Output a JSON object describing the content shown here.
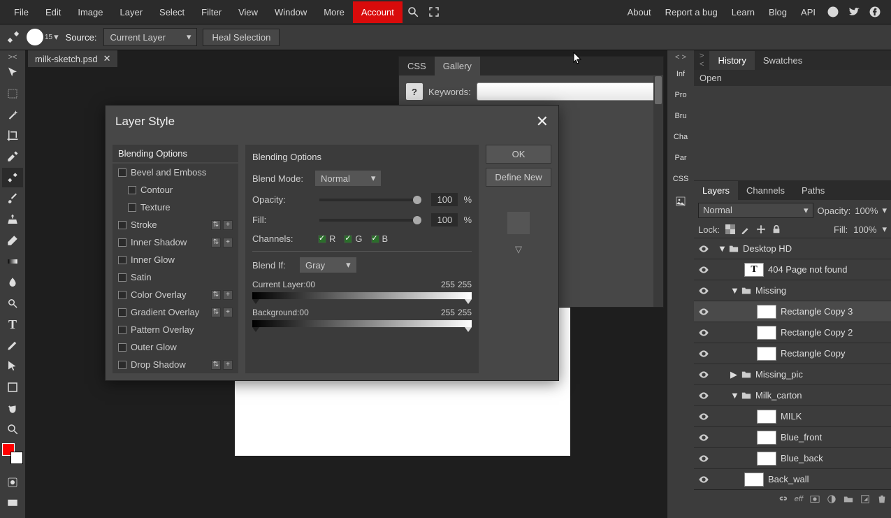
{
  "menubar": {
    "items": [
      "File",
      "Edit",
      "Image",
      "Layer",
      "Select",
      "Filter",
      "View",
      "Window",
      "More"
    ],
    "account": "Account",
    "right": [
      "About",
      "Report a bug",
      "Learn",
      "Blog",
      "API"
    ]
  },
  "optbar": {
    "brush_size": "15",
    "source_label": "Source:",
    "source_value": "Current Layer",
    "heal_btn": "Heal Selection"
  },
  "doc": {
    "tab_name": "milk-sketch.psd"
  },
  "gallery": {
    "tabs": [
      "CSS",
      "Gallery"
    ],
    "help": "?",
    "keywords_label": "Keywords:"
  },
  "sidetabs": [
    "Inf",
    "Pro",
    "Bru",
    "Cha",
    "Par",
    "CSS"
  ],
  "history_panel": {
    "tabs": [
      "History",
      "Swatches"
    ],
    "items": [
      "Open"
    ]
  },
  "layers_panel": {
    "tabs": [
      "Layers",
      "Channels",
      "Paths"
    ],
    "blend_mode": "Normal",
    "opacity_label": "Opacity:",
    "opacity_val": "100%",
    "lock_label": "Lock:",
    "fill_label": "Fill:",
    "fill_val": "100%",
    "rows": [
      {
        "name": "Desktop HD",
        "type": "folder",
        "open": true,
        "indent": 0
      },
      {
        "name": "404 Page not found",
        "type": "text",
        "indent": 1
      },
      {
        "name": "Missing",
        "type": "folder",
        "open": true,
        "indent": 1
      },
      {
        "name": "Rectangle Copy 3",
        "type": "shape",
        "indent": 2,
        "sel": true
      },
      {
        "name": "Rectangle Copy 2",
        "type": "shape",
        "indent": 2
      },
      {
        "name": "Rectangle Copy",
        "type": "shape",
        "indent": 2
      },
      {
        "name": "Missing_pic",
        "type": "folder",
        "open": false,
        "indent": 1
      },
      {
        "name": "Milk_carton",
        "type": "folder",
        "open": true,
        "indent": 1
      },
      {
        "name": "MILK",
        "type": "img",
        "indent": 2
      },
      {
        "name": "Blue_front",
        "type": "img",
        "indent": 2
      },
      {
        "name": "Blue_back",
        "type": "img",
        "indent": 2
      },
      {
        "name": "Back_wall",
        "type": "img",
        "indent": 1
      }
    ],
    "footer_eff": "eff"
  },
  "dialog": {
    "title": "Layer Style",
    "effects_header": "Blending Options",
    "effects": [
      {
        "label": "Bevel and Emboss",
        "cb": true
      },
      {
        "label": "Contour",
        "cb": true,
        "sub": true
      },
      {
        "label": "Texture",
        "cb": true,
        "sub": true
      },
      {
        "label": "Stroke",
        "cb": true,
        "acts": true
      },
      {
        "label": "Inner Shadow",
        "cb": true,
        "acts": true
      },
      {
        "label": "Inner Glow",
        "cb": true
      },
      {
        "label": "Satin",
        "cb": true
      },
      {
        "label": "Color Overlay",
        "cb": true,
        "acts": true
      },
      {
        "label": "Gradient Overlay",
        "cb": true,
        "acts": true
      },
      {
        "label": "Pattern Overlay",
        "cb": true
      },
      {
        "label": "Outer Glow",
        "cb": true
      },
      {
        "label": "Drop Shadow",
        "cb": true,
        "acts": true
      }
    ],
    "opts": {
      "header": "Blending Options",
      "blend_mode_l": "Blend Mode:",
      "blend_mode_v": "Normal",
      "opacity_l": "Opacity:",
      "opacity_v": "100",
      "pct": "%",
      "fill_l": "Fill:",
      "fill_v": "100",
      "channels_l": "Channels:",
      "ch_r": "R",
      "ch_g": "G",
      "ch_b": "B",
      "blendif_l": "Blend If:",
      "blendif_v": "Gray",
      "curlayer_l": "Current Layer:",
      "bg_l": "Background:",
      "v0a": "0",
      "v0b": "0",
      "v255a": "255",
      "v255b": "255"
    },
    "ok": "OK",
    "define_new": "Define New"
  }
}
